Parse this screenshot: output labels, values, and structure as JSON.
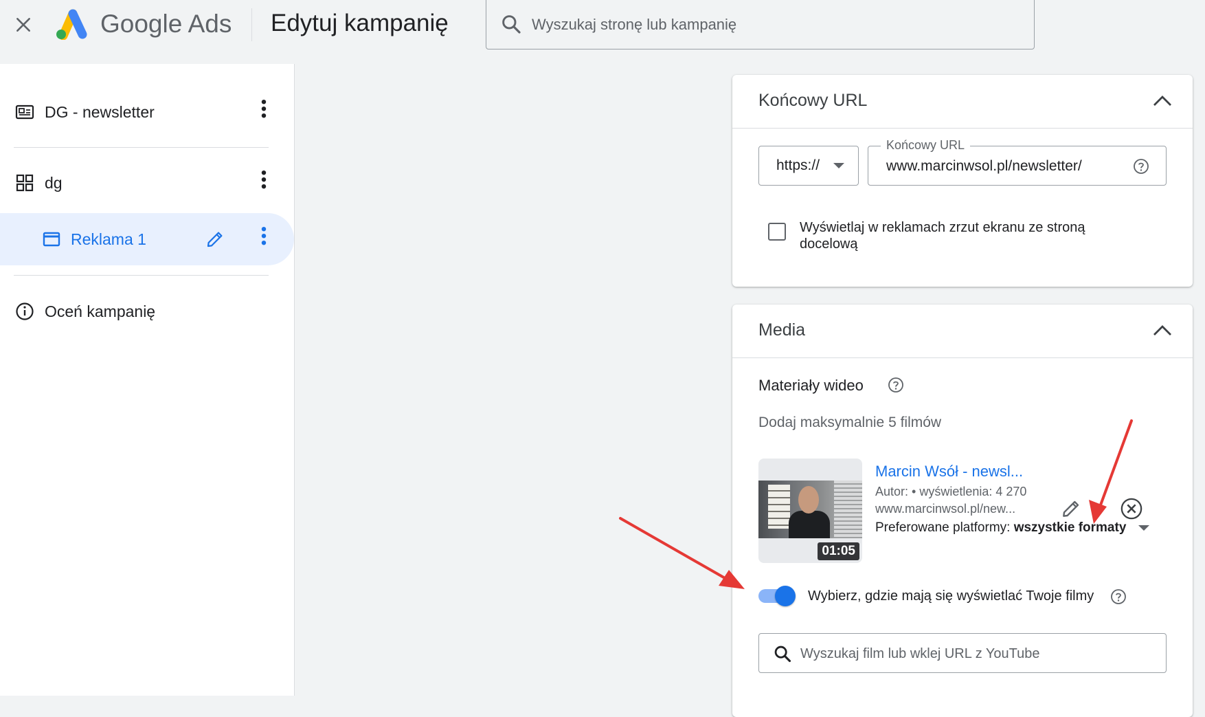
{
  "header": {
    "brand_google": "Google",
    "brand_ads": "Ads",
    "page_title": "Edytuj kampanię",
    "search_placeholder": "Wyszukaj stronę lub kampanię"
  },
  "sidebar": {
    "items": [
      {
        "label": "DG - newsletter",
        "icon": "display-ad-icon"
      },
      {
        "label": "dg",
        "icon": "grid-icon"
      },
      {
        "label": "Reklama 1",
        "icon": "window-icon",
        "selected": true
      },
      {
        "label": "Oceń kampanię",
        "icon": "info-icon"
      }
    ]
  },
  "final_url_card": {
    "title": "Końcowy URL",
    "protocol": "https://",
    "url_label": "Końcowy URL",
    "url_value": "www.marcinwsol.pl/newsletter/",
    "checkbox_label": "Wyświetlaj w reklamach zrzut ekranu ze stroną docelową",
    "checkbox_checked": false
  },
  "media_card": {
    "title": "Media",
    "section_title": "Materiały wideo",
    "hint": "Dodaj maksymalnie 5 filmów",
    "video": {
      "title": "Marcin Wsół - newsl...",
      "meta": "Autor:  • wyświetlenia: 4 270",
      "url": "www.marcinwsol.pl/new...",
      "platforms_label": "Preferowane platformy:",
      "platforms_value": "wszystkie formaty",
      "duration": "01:05"
    },
    "toggle_label": "Wybierz, gdzie mają się wyświetlać Twoje filmy",
    "toggle_on": true,
    "search_placeholder": "Wyszukaj film lub wklej URL z YouTube"
  },
  "colors": {
    "accent": "#1a73e8",
    "selected_bg": "#e8f0fe",
    "annotation_arrow": "#e53935"
  }
}
